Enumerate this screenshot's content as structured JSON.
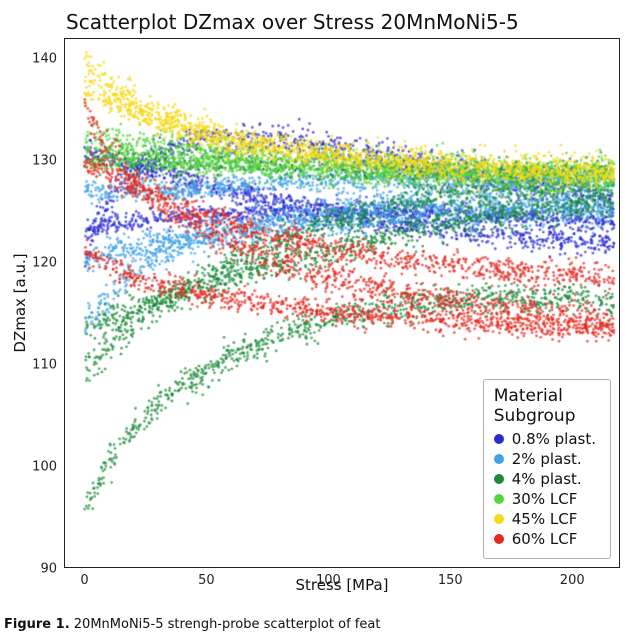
{
  "chart_data": {
    "type": "scatter",
    "title": "Scatterplot DZmax over Stress 20MnMoNi5-5",
    "xlabel": "Stress [MPa]",
    "ylabel": "DZmax [a.u.]",
    "xlim": [
      -8,
      220
    ],
    "ylim": [
      90,
      142
    ],
    "xticks": [
      0,
      50,
      100,
      150,
      200
    ],
    "yticks": [
      90,
      100,
      110,
      120,
      130,
      140
    ],
    "legend_title": "Material\nSubgroup",
    "legend_pos": "lower right",
    "series": [
      {
        "name": "0.8% plast.",
        "color": "#2b2bd4",
        "bands": [
          {
            "x": [
              0,
              5,
              10,
              20,
              35,
              50,
              80,
              110,
              140,
              170,
              200,
              218
            ],
            "y": [
              120,
              124,
              126,
              129,
              131,
              132,
              132,
              131,
              129.5,
              128,
              127,
              126
            ],
            "spread": 1.6
          },
          {
            "x": [
              0,
              10,
              30,
              60,
              100,
              140,
              180,
              218
            ],
            "y": [
              131,
              130,
              129,
              127,
              125,
              123.5,
              122.5,
              122
            ],
            "spread": 1.2
          },
          {
            "x": [
              0,
              15,
              40,
              80,
              130,
              180,
              218
            ],
            "y": [
              123,
              124,
              124.5,
              125,
              125,
              124.5,
              124
            ],
            "spread": 1.0
          }
        ]
      },
      {
        "name": "2% plast.",
        "color": "#3fa2e6",
        "bands": [
          {
            "x": [
              0,
              8,
              20,
              40,
              70,
              110,
              150,
              190,
              218
            ],
            "y": [
              114,
              116,
              119,
              122,
              124,
              125.5,
              126,
              126,
              126
            ],
            "spread": 1.5
          },
          {
            "x": [
              0,
              10,
              30,
              60,
              100,
              150,
              200,
              218
            ],
            "y": [
              120,
              121,
              122,
              123,
              124,
              124.5,
              125,
              125
            ],
            "spread": 1.4
          },
          {
            "x": [
              0,
              15,
              40,
              80,
              130,
              180,
              218
            ],
            "y": [
              127,
              127,
              127,
              128,
              128,
              128,
              128
            ],
            "spread": 1.0
          }
        ]
      },
      {
        "name": "4% plast.",
        "color": "#1b8a3a",
        "bands": [
          {
            "x": [
              0,
              5,
              10,
              20,
              35,
              55,
              80,
              110,
              140,
              170,
              200,
              218
            ],
            "y": [
              96,
              98,
              100.5,
              103.5,
              107,
              110,
              113,
              115,
              116,
              116.5,
              116.5,
              116
            ],
            "spread": 1.4
          },
          {
            "x": [
              0,
              5,
              12,
              25,
              45,
              70,
              100,
              135,
              170,
              200,
              218
            ],
            "y": [
              109,
              110,
              112,
              115,
              118,
              121,
              124,
              126,
              127,
              127.5,
              127.5
            ],
            "spread": 1.5
          },
          {
            "x": [
              0,
              10,
              30,
              60,
              100,
              150,
              200,
              218
            ],
            "y": [
              113.5,
              114.5,
              116,
              118.5,
              121,
              124,
              125.5,
              126
            ],
            "spread": 1.3
          },
          {
            "x": [
              0,
              15,
              40,
              80,
              130,
              180,
              218
            ],
            "y": [
              130,
              130,
              130,
              129.5,
              129,
              129,
              129
            ],
            "spread": 1.2
          }
        ]
      },
      {
        "name": "30% LCF",
        "color": "#54d63a",
        "bands": [
          {
            "x": [
              0,
              10,
              25,
              50,
              90,
              140,
              190,
              218
            ],
            "y": [
              132,
              132,
              131.5,
              131,
              130,
              129.5,
              129,
              129
            ],
            "spread": 1.5
          },
          {
            "x": [
              0,
              15,
              40,
              80,
              130,
              180,
              218
            ],
            "y": [
              130,
              130,
              129.7,
              129.3,
              128.7,
              128.3,
              128
            ],
            "spread": 1.2
          }
        ]
      },
      {
        "name": "45% LCF",
        "color": "#f5d915",
        "bands": [
          {
            "x": [
              0,
              5,
              12,
              25,
              45,
              70,
              100,
              140,
              180,
              218
            ],
            "y": [
              140,
              138.5,
              137,
              135,
              133,
              131.5,
              130.5,
              129.7,
              129.2,
              129
            ],
            "spread": 1.6
          },
          {
            "x": [
              0,
              10,
              30,
              60,
              100,
              150,
              200,
              218
            ],
            "y": [
              137,
              136,
              134,
              132,
              130.5,
              129.5,
              129,
              128.7
            ],
            "spread": 1.3
          }
        ]
      },
      {
        "name": "60% LCF",
        "color": "#e52920",
        "bands": [
          {
            "x": [
              0,
              4,
              10,
              20,
              35,
              55,
              80,
              110,
              140,
              170,
              200,
              218
            ],
            "y": [
              136,
              133.5,
              131,
              128,
              125,
              122.5,
              120,
              118,
              116.5,
              115.5,
              114.7,
              114
            ],
            "spread": 1.5
          },
          {
            "x": [
              0,
              8,
              20,
              40,
              70,
              110,
              160,
              218
            ],
            "y": [
              130,
              129,
              127.5,
              125.5,
              123,
              121,
              119.5,
              118.5
            ],
            "spread": 1.2
          },
          {
            "x": [
              0,
              5,
              12,
              25,
              45,
              75,
              115,
              160,
              200,
              218
            ],
            "y": [
              121,
              120.5,
              119.5,
              118,
              117,
              115.8,
              114.8,
              114,
              113.5,
              113.3
            ],
            "spread": 1.1
          }
        ]
      }
    ]
  },
  "caption": {
    "label": "Figure 1.",
    "text": "20MnMoNi5-5 strengh-probe scatterplot of feat"
  }
}
